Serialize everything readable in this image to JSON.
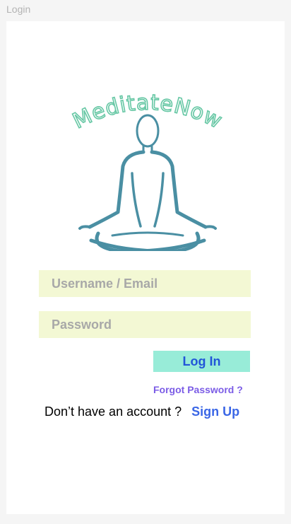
{
  "frame": {
    "label": "Login"
  },
  "logo": {
    "text": "MeditateNow",
    "icon": "meditation-figure-icon",
    "text_color": "#66c7a4",
    "figure_color": "#4a8fa3"
  },
  "form": {
    "username_placeholder": "Username / Email",
    "password_placeholder": "Password",
    "login_label": "Log In",
    "forgot_label": "Forgot Password ?",
    "field_color": "#f3f8d4",
    "button_color": "#98ecd8"
  },
  "signup": {
    "prompt": "Don’t have an account ?",
    "link_label": "Sign Up"
  }
}
